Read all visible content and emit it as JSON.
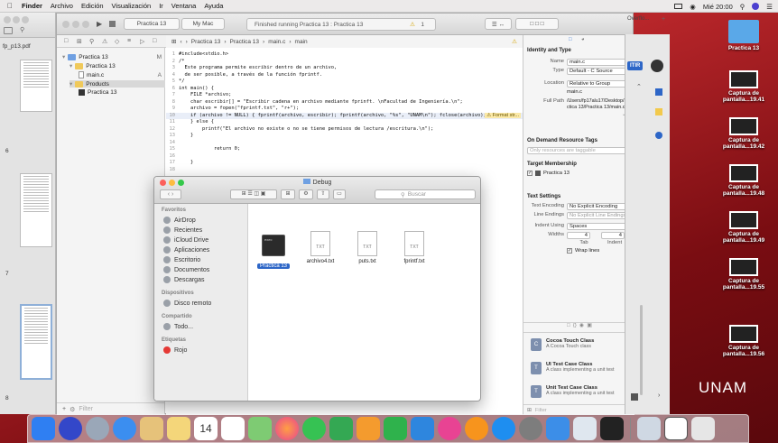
{
  "menubar": {
    "items": [
      "Finder",
      "Archivo",
      "Edición",
      "Visualización",
      "Ir",
      "Ventana",
      "Ayuda"
    ],
    "clock": "Mié 20:00"
  },
  "preview": {
    "file_name": "fp_p13.pdf",
    "pages": [
      "6",
      "7",
      "8"
    ]
  },
  "xcode": {
    "scheme": "Practica 13",
    "destination": "My Mac",
    "status": "Finished running Practica 13 : Practica 13",
    "warning_count": "1",
    "navigator": {
      "project": "Practica 13",
      "project_badge": "M",
      "group": "Practica 13",
      "file": "main.c",
      "file_badge": "A",
      "products": "Products",
      "product": "Practica 13"
    },
    "jumpbar": [
      "Practica 13",
      "Practica 13",
      "main.c",
      "main"
    ],
    "code": [
      {
        "n": "1",
        "t": "#include<stdio.h>"
      },
      {
        "n": "2",
        "t": "/*"
      },
      {
        "n": "3",
        "t": "  Este programa permite escribir dentro de un archivo,"
      },
      {
        "n": "4",
        "t": "  de ser posible, a través de la función fprintf."
      },
      {
        "n": "5",
        "t": "*/"
      },
      {
        "n": "6",
        "t": "int main() {"
      },
      {
        "n": "7",
        "t": "    FILE *archivo;"
      },
      {
        "n": "8",
        "t": "    char escribir[] = \"Escribir cadena en archivo mediante fprinft. \\nFacultad de Ingeniería.\\n\";"
      },
      {
        "n": "9",
        "t": "    archivo = fopen(\"fprintf.txt\", \"r+\");"
      },
      {
        "n": "10",
        "t": "    if (archivo != NULL) { fprintf(archivo, escribir); fprintf(archivo, \"%s\", \"UNAM\\n\"); fclose(archivo); }"
      },
      {
        "n": "11",
        "t": "    } else {"
      },
      {
        "n": "12",
        "t": "        printf(\"El archivo no existe o no se tiene permisos de lectura /escritura.\\n\");"
      },
      {
        "n": "13",
        "t": "    }"
      },
      {
        "n": "14",
        "t": ""
      },
      {
        "n": "15",
        "t": "            return 0;"
      },
      {
        "n": "16",
        "t": ""
      },
      {
        "n": "17",
        "t": "    }"
      },
      {
        "n": "18",
        "t": ""
      }
    ],
    "warning_label": "Format str...",
    "inspector": {
      "identity_title": "Identity and Type",
      "name_label": "Name",
      "name_value": "main.c",
      "type_label": "Type",
      "type_value": "Default - C Source",
      "location_label": "Location",
      "location_value": "Relative to Group",
      "location_file": "main.c",
      "fullpath_label": "Full Path",
      "fullpath_value": "/Users/fp17alu17/Desktop/Practica 13/Practica 13/main.c",
      "odr_title": "On Demand Resource Tags",
      "odr_placeholder": "Only resources are taggable",
      "target_title": "Target Membership",
      "target_item": "Practica 13",
      "text_title": "Text Settings",
      "encoding_label": "Text Encoding",
      "encoding_value": "No Explicit Encoding",
      "endings_label": "Line Endings",
      "endings_value": "No Explicit Line Endings",
      "indent_label": "Indent Using",
      "indent_value": "Spaces",
      "widths_label": "Widths",
      "tab_value": "4",
      "indent_width_value": "4",
      "tab_label": "Tab",
      "indent_label2": "Indent",
      "wrap_label": "Wrap lines",
      "templates": [
        {
          "title": "Cocoa Touch Class",
          "desc": "A Cocoa Touch class",
          "icon": "C"
        },
        {
          "title": "UI Test Case Class",
          "desc": "A class implementing a unit test",
          "icon": "T"
        },
        {
          "title": "Unit Test Case Class",
          "desc": "A class implementing a unit test",
          "icon": "T"
        }
      ],
      "filter_placeholder": "Filter"
    },
    "nav_filter": "Filter"
  },
  "strip": {
    "tab_label": "Overflo...",
    "btn_label": "ITIR"
  },
  "finder": {
    "title": "Debug",
    "search_placeholder": "Buscar",
    "sidebar": {
      "favorites_title": "Favoritos",
      "favorites": [
        "AirDrop",
        "Recientes",
        "iCloud Drive",
        "Aplicaciones",
        "Escritorio",
        "Documentos",
        "Descargas"
      ],
      "devices_title": "Dispositivos",
      "devices": [
        "Disco remoto"
      ],
      "shared_title": "Compartido",
      "shared": [
        "Todo..."
      ],
      "tags_title": "Etiquetas",
      "tags": [
        "Rojo"
      ]
    },
    "files": [
      {
        "name": "Practica 13",
        "kind": "exec",
        "badge": "exec"
      },
      {
        "name": "archivo4.txt",
        "kind": "txt",
        "badge": "TXT"
      },
      {
        "name": "puts.txt",
        "kind": "txt",
        "badge": "TXT"
      },
      {
        "name": "fprintf.txt",
        "kind": "txt",
        "badge": "TXT"
      }
    ]
  },
  "desktop": {
    "icons": [
      {
        "label": "Practica 13",
        "kind": "folder"
      },
      {
        "label": "Captura de pantalla...19.41",
        "kind": "shot"
      },
      {
        "label": "Captura de pantalla...19.42",
        "kind": "shot"
      },
      {
        "label": "Captura de pantalla...19.48",
        "kind": "shot"
      },
      {
        "label": "Captura de pantalla...19.49",
        "kind": "shot"
      },
      {
        "label": "Captura de pantalla...19.55",
        "kind": "shot"
      },
      {
        "label": "Captura de pantalla...19.56",
        "kind": "shot"
      }
    ],
    "wallpaper_text": "UNAM"
  },
  "dock": {
    "calendar_day": "14",
    "apps": [
      "finder-icon",
      "siri-icon",
      "launchpad-icon",
      "safari-icon",
      "photos-icon",
      "notes-icon",
      "calendar-icon",
      "reminders-icon",
      "maps-icon",
      "photos2-icon",
      "messages-icon",
      "facetime-icon",
      "pages-icon",
      "numbers-icon",
      "keynote-icon",
      "itunes-icon",
      "ibooks-icon",
      "appstore-icon",
      "preferences-icon",
      "xcode-icon",
      "preview-icon",
      "terminal-icon",
      "downloads-icon",
      "window-icon",
      "trash-icon"
    ]
  }
}
